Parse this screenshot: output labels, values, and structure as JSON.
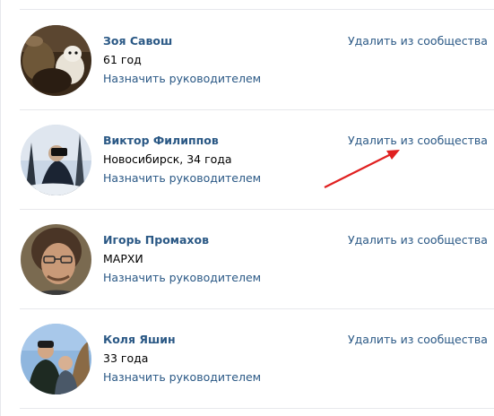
{
  "members": [
    {
      "name": "Зоя Савош",
      "info": "61 год",
      "assign_label": "Назначить руководителем",
      "remove_label": "Удалить из сообщества"
    },
    {
      "name": "Виктор Филиппов",
      "info": "Новосибирск, 34 года",
      "assign_label": "Назначить руководителем",
      "remove_label": "Удалить из сообщества"
    },
    {
      "name": "Игорь Промахов",
      "info": "МАРХИ",
      "assign_label": "Назначить руководителем",
      "remove_label": "Удалить из сообщества"
    },
    {
      "name": "Коля Яшин",
      "info": "33 года",
      "assign_label": "Назначить руководителем",
      "remove_label": "Удалить из сообщества"
    }
  ],
  "colors": {
    "link": "#2a5885",
    "separator": "#e7e8ec",
    "annotation_arrow": "#e02020"
  }
}
